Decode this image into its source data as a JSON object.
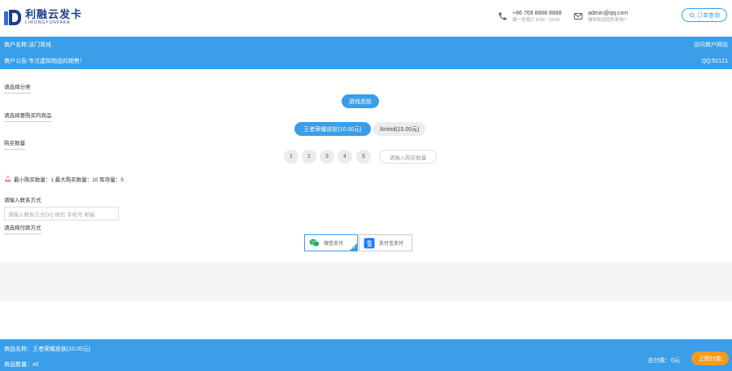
{
  "header": {
    "logo_cn": "利融云发卡",
    "logo_en": "LIRONGYUNFAKA",
    "phone": "+86 769 8888 8888",
    "phone_hours": "周一至周六 8:00 - 22:00",
    "email": "admin@qq.com",
    "email_note": "随时欢迎您的来信！",
    "order_query": "订单查询",
    "accent_color": "#3a9ee8"
  },
  "merchant": {
    "name": "商户名称:法门青线",
    "visit_link": "访问商户网站",
    "notice": "商户公告:专注虚拟物品的销售！",
    "qq": "QQ:52121"
  },
  "form": {
    "category_label": "请选择分类",
    "category_options": [
      "游戏皮肤"
    ],
    "product_label": "请选择要购买的商品",
    "product_options": [
      "王者荣耀皮肤(10.00元)",
      "Xmind(15.00元)"
    ],
    "quantity_label": "购买数量",
    "quantity_options": [
      "1",
      "2",
      "3",
      "4",
      "5"
    ],
    "quantity_placeholder": "请输入购买数量",
    "limits": "最小购买数量：1 最大购买数量：10 库存量：5",
    "contact_label": "请输入联系方式",
    "contact_placeholder": "请输入联系方式QQ 微信 手机号 邮箱",
    "payment_label": "请选择付款方式",
    "payment_options": [
      {
        "label": "微信支付",
        "icon": "wechat-icon",
        "color": "#2aae67"
      },
      {
        "label": "支付宝支付",
        "icon": "alipay-icon",
        "color": "#1677ff"
      }
    ]
  },
  "footer": {
    "product_name": "商品名称：王者荣耀皮肤(10.00元)",
    "product_qty": "商品数量：x0",
    "paid": "应付款：0元",
    "buy_button": "立即付款",
    "button_color": "#f39b20"
  }
}
